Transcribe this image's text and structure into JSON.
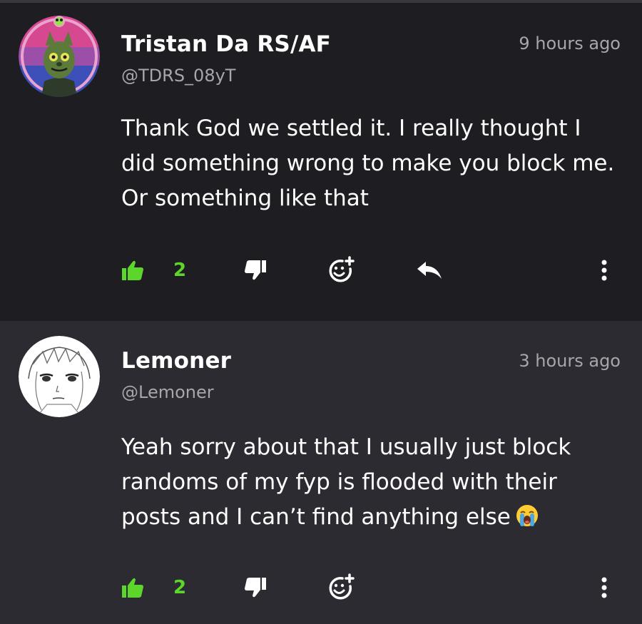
{
  "comments": [
    {
      "name": "Tristan Da RS/AF",
      "handle": "@TDRS_08yT",
      "time": "9 hours ago",
      "text": "Thank God we settled it. I really thought I did something wrong to make you block me. Or something like that",
      "likes": "2",
      "has_reply": true
    },
    {
      "name": "Lemoner",
      "handle": "@Lemoner",
      "time": "3 hours ago",
      "text": "Yeah sorry about that I usually just block randoms of my fyp is flooded with their posts and I can’t find anything else",
      "emoji": "loudly-crying-face",
      "likes": "2",
      "has_reply": false
    }
  ],
  "icons": {
    "like": "thumbs-up-icon",
    "dislike": "thumbs-down-icon",
    "react": "add-reaction-icon",
    "reply": "reply-arrow-icon",
    "more": "more-vertical-icon"
  },
  "colors": {
    "accent": "#5dd62c",
    "background": "#1e1d22",
    "background_alt": "#2c2b31",
    "text": "#ffffff",
    "muted": "#a7a6ab"
  }
}
